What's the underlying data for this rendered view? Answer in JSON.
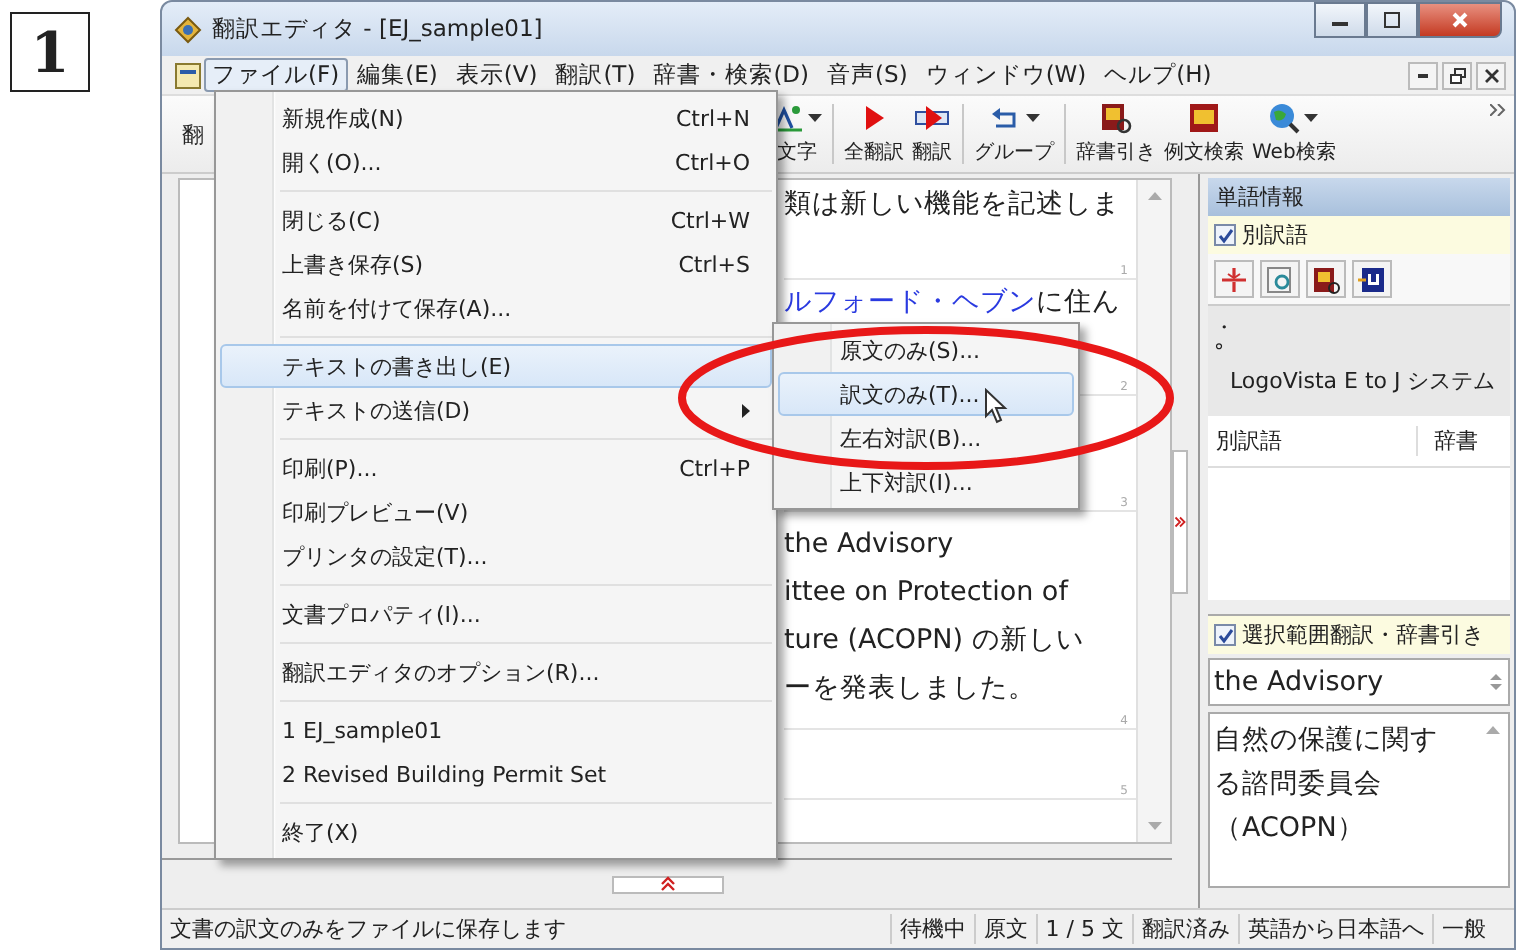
{
  "step_badge": "1",
  "window": {
    "title": "翻訳エディタ - [EJ_sample01]"
  },
  "menubar": [
    {
      "label": "ファイル(F)",
      "selected": true
    },
    {
      "label": "編集(E)",
      "selected": false
    },
    {
      "label": "表示(V)",
      "selected": false
    },
    {
      "label": "翻訳(T)",
      "selected": false
    },
    {
      "label": "辞書・検索(D)",
      "selected": false
    },
    {
      "label": "音声(S)",
      "selected": false
    },
    {
      "label": "ウィンドウ(W)",
      "selected": false
    },
    {
      "label": "ヘルプ(H)",
      "selected": false
    }
  ],
  "toolbar": {
    "cut_label": "翻",
    "buttons": [
      {
        "label": "文字",
        "kind": "font",
        "dropdown": true
      },
      {
        "label": "全翻訳",
        "kind": "translate-all",
        "dropdown": false
      },
      {
        "label": "翻訳",
        "kind": "translate",
        "dropdown": false
      },
      {
        "label": "グループ",
        "kind": "group",
        "dropdown": true
      },
      {
        "label": "辞書引き",
        "kind": "dictionary",
        "dropdown": false
      },
      {
        "label": "例文検索",
        "kind": "example",
        "dropdown": false
      },
      {
        "label": "Web検索",
        "kind": "web",
        "dropdown": true
      }
    ]
  },
  "file_menu": [
    [
      {
        "label": "新規作成(N)",
        "shortcut": "Ctrl+N",
        "selected": false,
        "submenu": false
      },
      {
        "label": "開く(O)...",
        "shortcut": "Ctrl+O",
        "selected": false,
        "submenu": false
      }
    ],
    [
      {
        "label": "閉じる(C)",
        "shortcut": "Ctrl+W",
        "selected": false,
        "submenu": false
      },
      {
        "label": "上書き保存(S)",
        "shortcut": "Ctrl+S",
        "selected": false,
        "submenu": false
      },
      {
        "label": "名前を付けて保存(A)...",
        "selected": false,
        "submenu": false
      }
    ],
    [
      {
        "label": "テキストの書き出し(E)",
        "selected": true,
        "submenu": false
      },
      {
        "label": "テキストの送信(D)",
        "selected": false,
        "submenu": true
      }
    ],
    [
      {
        "label": "印刷(P)...",
        "shortcut": "Ctrl+P",
        "selected": false,
        "submenu": false
      },
      {
        "label": "印刷プレビュー(V)",
        "selected": false,
        "submenu": false
      },
      {
        "label": "プリンタの設定(T)...",
        "selected": false,
        "submenu": false
      }
    ],
    [
      {
        "label": "文書プロパティ(I)...",
        "selected": false,
        "submenu": false
      }
    ],
    [
      {
        "label": "翻訳エディタのオプション(R)...",
        "selected": false,
        "submenu": false
      }
    ],
    [
      {
        "label": "1 EJ_sample01",
        "selected": false,
        "submenu": false
      },
      {
        "label": "2 Revised Building Permit Set",
        "selected": false,
        "submenu": false
      }
    ],
    [
      {
        "label": "終了(X)",
        "selected": false,
        "submenu": false
      }
    ]
  ],
  "submenu": [
    {
      "label": "原文のみ(S)...",
      "selected": false
    },
    {
      "label": "訳文のみ(T)...",
      "selected": true
    },
    {
      "label": "左右対訳(B)...",
      "selected": false
    },
    {
      "label": "上下対訳(I)...",
      "selected": false
    }
  ],
  "editor": {
    "segments": [
      {
        "marker": "1",
        "lines": [
          {
            "text": "類は新しい機能を記述しま"
          }
        ]
      },
      {
        "marker": "2",
        "lines": [
          {
            "link": "ルフォード・ヘブン",
            "text": "に住ん"
          }
        ]
      },
      {
        "marker": "3"
      },
      {
        "marker": "4",
        "lines": [
          {
            "text": "the Advisory"
          },
          {
            "text": "ittee on Protection of"
          },
          {
            "text": "ture (ACOPN) の新しい"
          },
          {
            "text": "ーを発表しました。"
          }
        ]
      },
      {
        "marker": "5"
      }
    ]
  },
  "word_panel": {
    "title": "単語情報",
    "alt_words": {
      "label": "別訳語",
      "checked": true
    },
    "info_lines": [
      "・",
      "°",
      "LogoVista E to J システム"
    ],
    "columns": [
      "別訳語",
      "辞書"
    ],
    "selection": {
      "label": "選択範囲翻訳・辞書引き",
      "checked": true
    },
    "source_value": "the Advisory",
    "result_lines": [
      "自然の保護に関す",
      "る諮問委員会",
      "（ACOPN）"
    ]
  },
  "status_bar": {
    "message": "文書の訳文のみをファイルに保存します",
    "fields": [
      "待機中",
      "原文",
      "1 / 5 文",
      "翻訳済み",
      "英語から日本語へ",
      "一般"
    ]
  }
}
